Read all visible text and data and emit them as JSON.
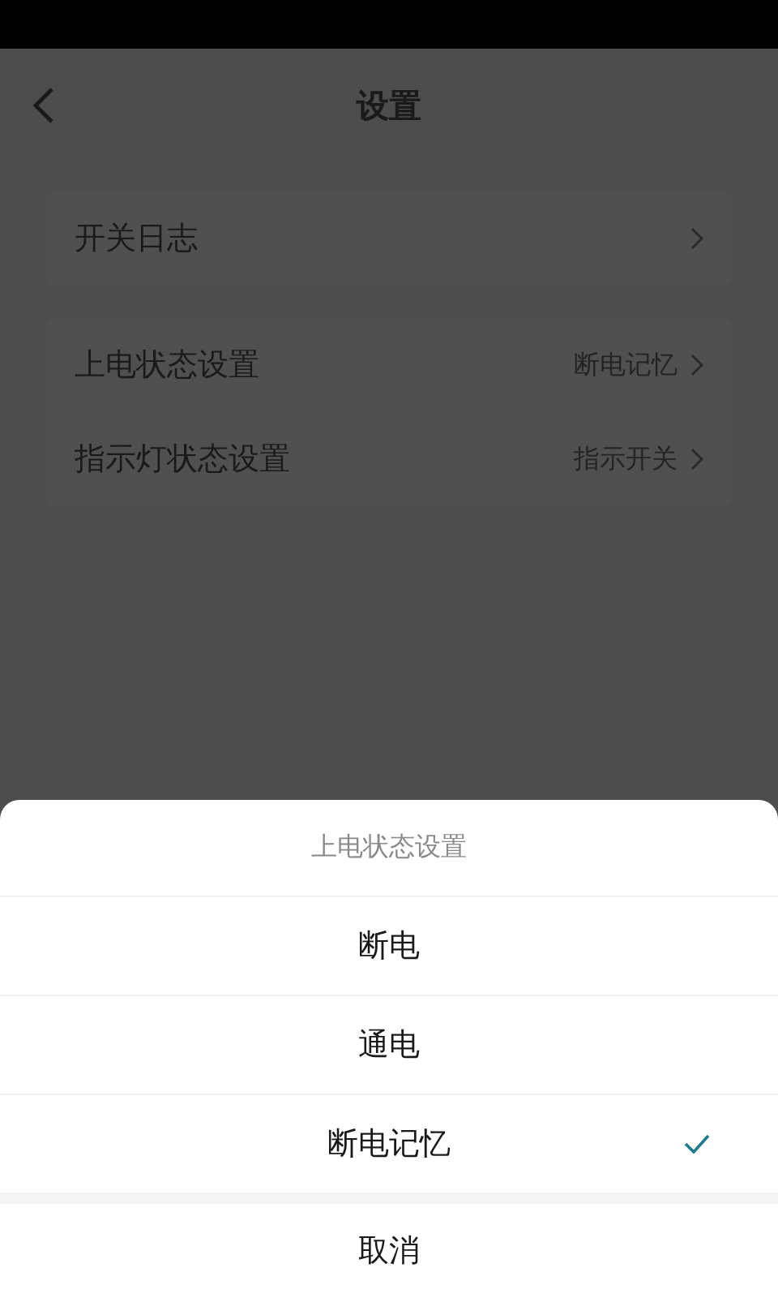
{
  "header": {
    "title": "设置"
  },
  "groups": [
    {
      "items": [
        {
          "label": "开关日志"
        }
      ]
    },
    {
      "items": [
        {
          "label": "上电状态设置",
          "value": "断电记忆"
        },
        {
          "label": "指示灯状态设置",
          "value": "指示开关"
        }
      ]
    }
  ],
  "sheet": {
    "title": "上电状态设置",
    "options": [
      {
        "label": "断电",
        "selected": false
      },
      {
        "label": "通电",
        "selected": false
      },
      {
        "label": "断电记忆",
        "selected": true
      }
    ],
    "cancel": "取消"
  }
}
